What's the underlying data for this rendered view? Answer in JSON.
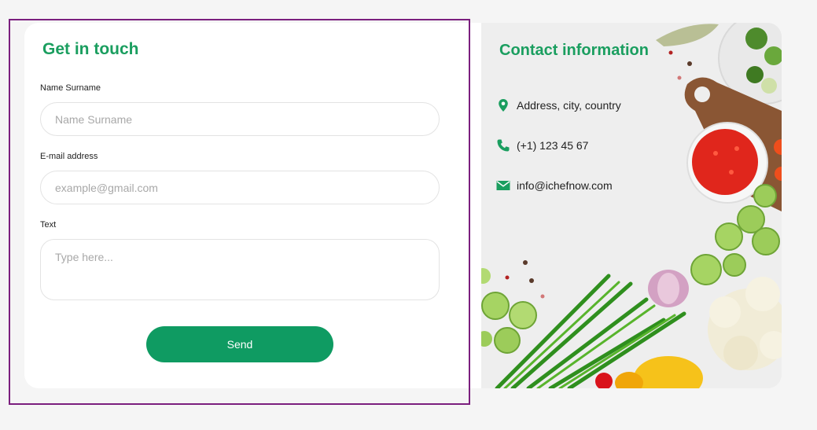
{
  "form": {
    "title": "Get in touch",
    "name_label": "Name Surname",
    "name_placeholder": "Name Surname",
    "email_label": "E-mail address",
    "email_placeholder": "example@gmail.com",
    "text_label": "Text",
    "text_placeholder": "Type here...",
    "send_label": "Send"
  },
  "contact": {
    "title": "Contact information",
    "address": "Address, city, country",
    "phone": "(+1) 123 45 67",
    "email": "info@ichefnow.com"
  },
  "colors": {
    "accent": "#1a9e5f",
    "button": "#0f9b62",
    "selection": "#7b1f7e",
    "background": "#f5f5f5"
  },
  "icons": {
    "address": "location-pin-icon",
    "phone": "phone-icon",
    "email": "envelope-icon"
  }
}
